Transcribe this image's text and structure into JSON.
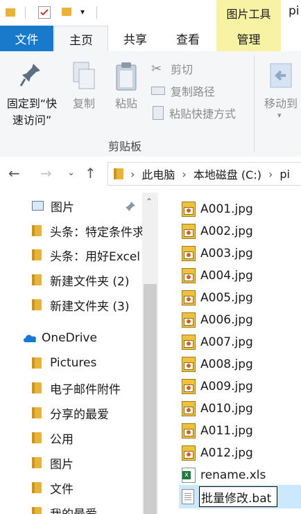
{
  "titlebar": {
    "title": "pi",
    "context_tab": "图片工具"
  },
  "tabs": {
    "file": "文件",
    "home": "主页",
    "share": "共享",
    "view": "查看",
    "manage": "管理"
  },
  "ribbon": {
    "pin_line1": "固定到“快",
    "pin_line2": "速访问”",
    "copy": "复制",
    "paste": "粘贴",
    "cut": "剪切",
    "copy_path": "复制路径",
    "paste_shortcut": "粘贴快捷方式",
    "move_to": "移动到",
    "group_label": "剪贴板"
  },
  "address": {
    "crumbs": [
      "此电脑",
      "本地磁盘 (C:)",
      "pi"
    ]
  },
  "nav": {
    "quick_items": [
      "图片",
      "头条：特定条件求和",
      "头条：用好Excel",
      "新建文件夹 (2)",
      "新建文件夹 (3)"
    ],
    "onedrive": "OneDrive",
    "onedrive_items": [
      "Pictures",
      "电子邮件附件",
      "分享的最爱",
      "公用",
      "图片",
      "文件",
      "我的最爱"
    ]
  },
  "files": [
    "A001.jpg",
    "A002.jpg",
    "A003.jpg",
    "A004.jpg",
    "A005.jpg",
    "A006.jpg",
    "A007.jpg",
    "A008.jpg",
    "A009.jpg",
    "A010.jpg",
    "A011.jpg",
    "A012.jpg"
  ],
  "other_files": {
    "xls": "rename.xls",
    "bat_rename_value": "批量修改.bat"
  },
  "colors": {
    "file_tab": "#1979ca",
    "context_tab": "#f7f2a4",
    "folder": "#e8b33a"
  }
}
